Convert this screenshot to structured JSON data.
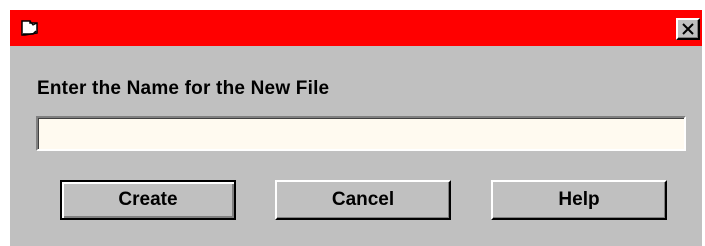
{
  "window": {
    "title": "",
    "close_label": "Close",
    "colors": {
      "titlebar": "#ff0000",
      "dialog_bg": "#c0c0c0",
      "input_bg": "#fffaf0"
    },
    "icons": {
      "app": "document-icon",
      "close": "close-icon"
    }
  },
  "form": {
    "prompt": "Enter the Name for the New File",
    "filename_value": "",
    "filename_placeholder": ""
  },
  "buttons": {
    "create_label": "Create",
    "cancel_label": "Cancel",
    "help_label": "Help"
  }
}
